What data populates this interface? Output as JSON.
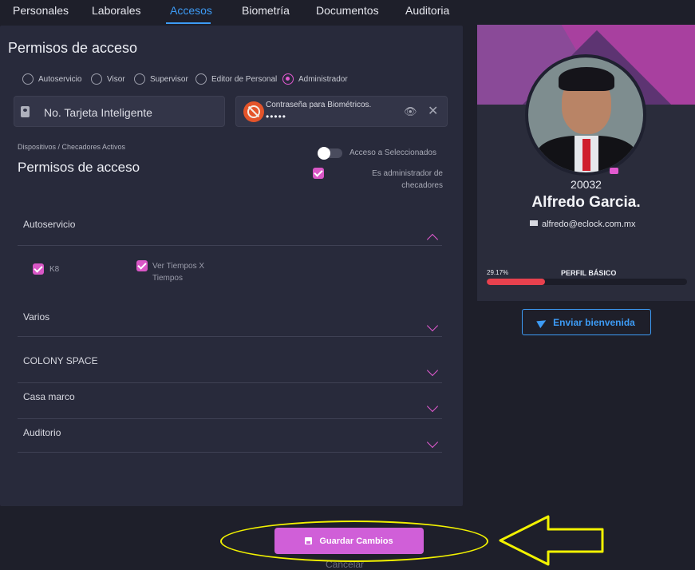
{
  "tabs": [
    {
      "label": "Personales"
    },
    {
      "label": "Laborales"
    },
    {
      "label": "Accesos"
    },
    {
      "label": "Biometría"
    },
    {
      "label": "Documentos"
    },
    {
      "label": "Auditoria"
    }
  ],
  "active_tab": "Accesos",
  "main": {
    "title": "Permisos de acceso",
    "radios": [
      {
        "label": "Autoservicio",
        "checked": false
      },
      {
        "label": "Visor",
        "checked": false
      },
      {
        "label": "Supervisor",
        "checked": false
      },
      {
        "label": "Editor de Personal",
        "checked": false
      },
      {
        "label": "Administrador",
        "checked": true
      }
    ],
    "smart_card_field": {
      "value": "No. Tarjeta Inteligente",
      "icon": "id-card-icon"
    },
    "biometric_password": {
      "label": "Contraseña para Biométricos.",
      "value": "•••••",
      "icon": "no-fingerprint-icon"
    },
    "devices_label": "Dispositivos / Checadores Activos",
    "section_title": "Permisos de acceso",
    "toggle_label": "Acceso a Seleccionados",
    "toggle_on": false,
    "admin_checkbox_label": "Es administrador de checadores",
    "admin_checked": true,
    "accordions": [
      {
        "title": "Autoservicio",
        "expanded": true,
        "items": [
          {
            "label": "K8",
            "checked": true
          },
          {
            "label": "Ver Tiempos X Tiempos",
            "checked": true
          }
        ]
      },
      {
        "title": "Varios",
        "expanded": false
      },
      {
        "title": "COLONY SPACE",
        "expanded": false
      },
      {
        "title": "Casa marco",
        "expanded": false
      },
      {
        "title": "Auditorio",
        "expanded": false
      }
    ]
  },
  "profile": {
    "employee_id": "20032",
    "name": "Alfredo Garcia.",
    "email": "alfredo@eclock.com.mx",
    "progress_label": "29.17%",
    "progress_value": 0.2917,
    "profile_level": "PERFIL BÁSICO",
    "welcome_button": "Enviar bienvenida"
  },
  "footer": {
    "save_button": "Guardar Cambios",
    "cancel": "Cancelar"
  },
  "colors": {
    "accent_blue": "#3d9bf5",
    "accent_pink": "#e25ad0",
    "progress_red": "#e8414e",
    "annotation_yellow": "#f2f200"
  }
}
